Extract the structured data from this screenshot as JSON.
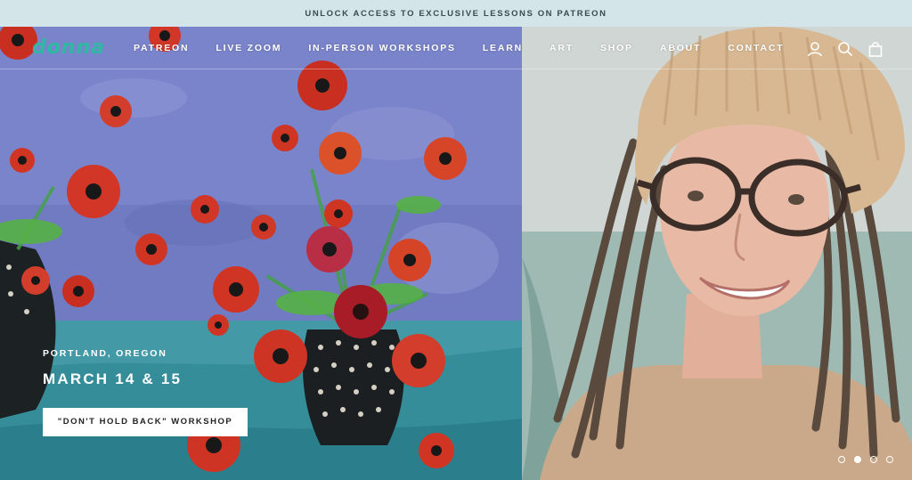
{
  "announcement": {
    "text": "UNLOCK ACCESS TO EXCLUSIVE LESSONS ON PATREON"
  },
  "header": {
    "logo": "donna",
    "nav": [
      "PATREON",
      "LIVE ZOOM",
      "IN-PERSON WORKSHOPS",
      "LEARN",
      "ART",
      "SHOP",
      "ABOUT",
      "CONTACT"
    ],
    "icons": [
      "account-icon",
      "search-icon",
      "cart-icon"
    ]
  },
  "hero": {
    "location": "PORTLAND, OREGON",
    "date": "MARCH 14 & 15",
    "cta_label": "\"DON'T HOLD BACK\" WORKSHOP",
    "slides_total": 4,
    "active_slide": 2
  },
  "colors": {
    "announcement_bg": "#d4e5ea",
    "logo": "#2fb9a5",
    "painting_bg": "#7a86d6"
  }
}
